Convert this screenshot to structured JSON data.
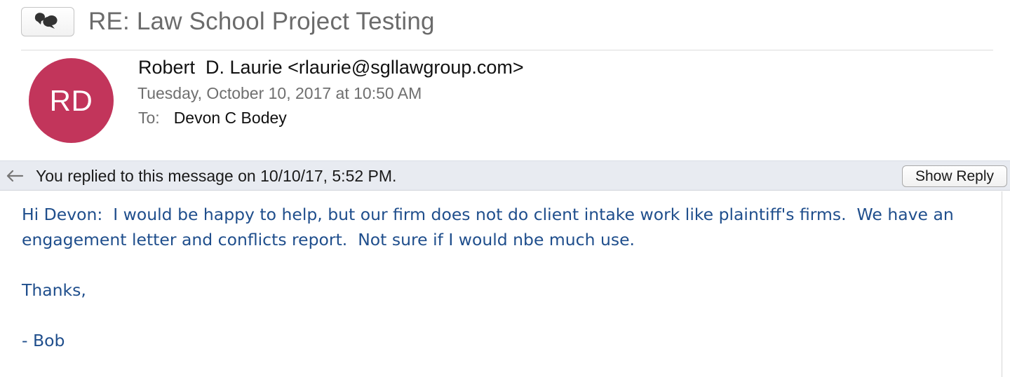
{
  "header": {
    "subject": "RE: Law School Project Testing",
    "avatar_initials": "RD",
    "sender": "Robert  D. Laurie <rlaurie@sgllawgroup.com>",
    "date": "Tuesday, October 10, 2017 at 10:50 AM",
    "to_label": "To:",
    "to_value": "Devon C Bodey"
  },
  "banner": {
    "text": "You replied to this message on 10/10/17, 5:52 PM.",
    "button_label": "Show Reply"
  },
  "body": {
    "line1": "Hi Devon:  I would be happy to help, but our firm does not do client intake work like plaintiff's firms.  We have an",
    "line2": "engagement letter and conflicts report.  Not sure if I would nbe much use.",
    "line3": "Thanks,",
    "line4": "- Bob"
  },
  "colors": {
    "avatar": "#c2355b",
    "body_text": "#1f4e8c",
    "banner_bg": "#e8ebf1"
  },
  "icons": {
    "conversation": "speech-bubbles-icon",
    "reply": "reply-arrow-icon"
  }
}
